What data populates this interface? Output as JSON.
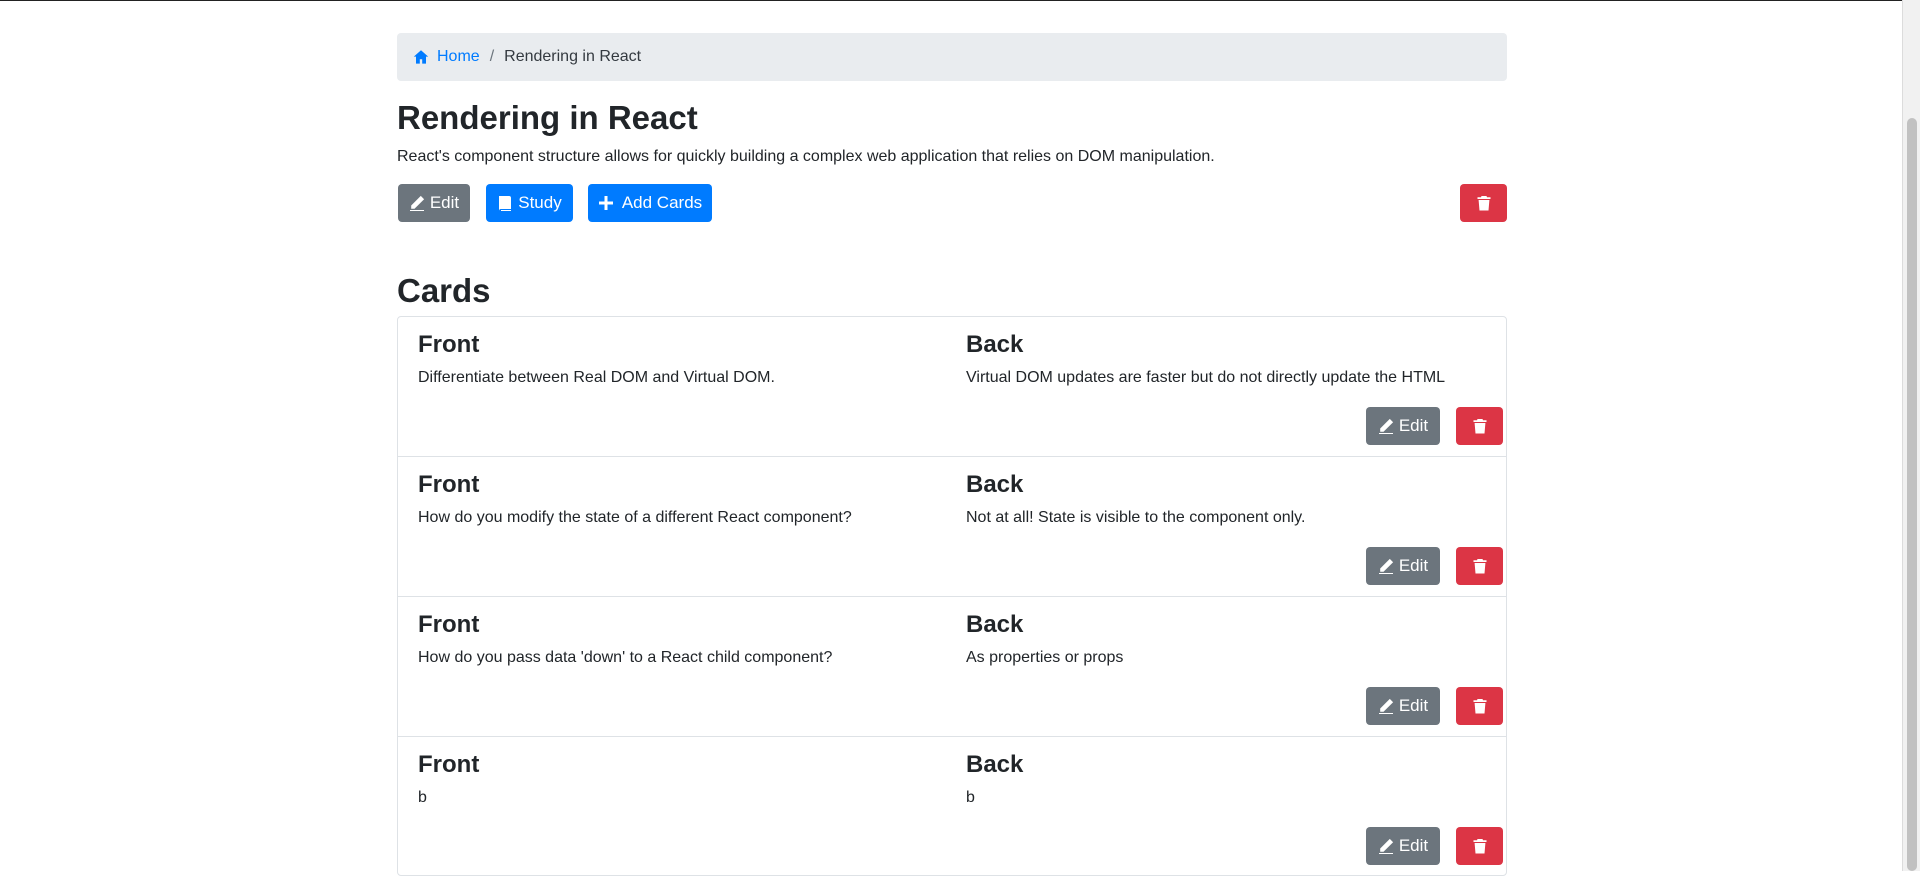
{
  "breadcrumb": {
    "home_label": "Home",
    "current_label": "Rendering in React"
  },
  "deck": {
    "title": "Rendering in React",
    "description": "React's component structure allows for quickly building a complex web application that relies on DOM manipulation.",
    "edit_label": "Edit",
    "study_label": "Study",
    "add_cards_label": "Add Cards"
  },
  "cards_section": {
    "title": "Cards",
    "items": [
      {
        "front_heading": "Front",
        "front": "Differentiate between Real DOM and Virtual DOM.",
        "back_heading": "Back",
        "back": "Virtual DOM updates are faster but do not directly update the HTML",
        "edit_label": "Edit"
      },
      {
        "front_heading": "Front",
        "front": "How do you modify the state of a different React component?",
        "back_heading": "Back",
        "back": "Not at all! State is visible to the component only.",
        "edit_label": "Edit"
      },
      {
        "front_heading": "Front",
        "front": "How do you pass data 'down' to a React child component?",
        "back_heading": "Back",
        "back": "As properties or props",
        "edit_label": "Edit"
      },
      {
        "front_heading": "Front",
        "front": "b",
        "back_heading": "Back",
        "back": "b",
        "edit_label": "Edit"
      }
    ]
  },
  "colors": {
    "primary": "#007bff",
    "secondary": "#6c757d",
    "danger": "#dc3545",
    "breadcrumb_bg": "#e9ecef"
  },
  "icons": {
    "home": "home-icon",
    "edit": "pencil-icon",
    "study": "book-icon",
    "add": "plus-icon",
    "delete": "trash-icon"
  }
}
